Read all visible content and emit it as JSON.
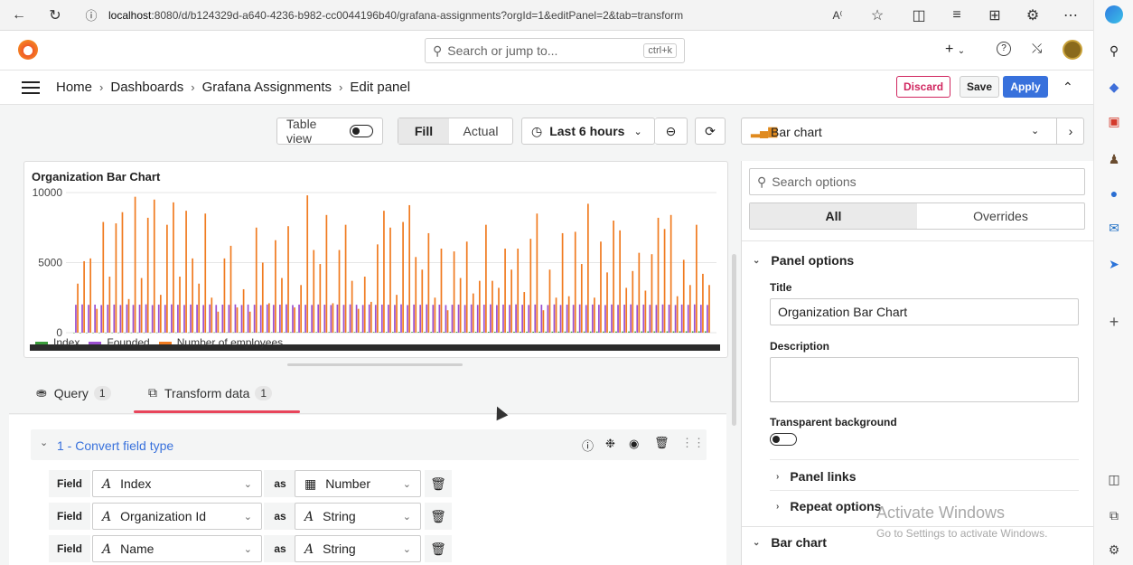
{
  "browser": {
    "url_host": "localhost",
    "url_rest": ":8080/d/b124329d-a640-4236-b982-cc0044196b40/grafana-assignments?orgId=1&editPanel=2&tab=transform"
  },
  "topnav": {
    "search_placeholder": "Search or jump to...",
    "search_shortcut": "ctrl+k",
    "new_label": "+"
  },
  "breadcrumbs": [
    "Home",
    "Dashboards",
    "Grafana Assignments",
    "Edit panel"
  ],
  "actions": {
    "discard": "Discard",
    "save": "Save",
    "apply": "Apply"
  },
  "toolbar": {
    "table_view": "Table view",
    "fill": "Fill",
    "actual": "Actual",
    "time_range": "Last 6 hours"
  },
  "panel": {
    "title": "Organization Bar Chart",
    "legend": [
      {
        "name": "Index",
        "color": "#3a9c3a"
      },
      {
        "name": "Founded",
        "color": "#9b4fcf"
      },
      {
        "name": "Number of employees",
        "color": "#f07b20"
      }
    ]
  },
  "chart_data": {
    "type": "bar",
    "ylim": [
      0,
      10000
    ],
    "yticks": [
      0,
      5000,
      10000
    ],
    "series": [
      {
        "name": "Index",
        "values": [
          1,
          2,
          3,
          4,
          5,
          6,
          7,
          8,
          9,
          10,
          11,
          12,
          13,
          14,
          15,
          16,
          17,
          18,
          19,
          20,
          21,
          22,
          23,
          24,
          25,
          26,
          27,
          28,
          29,
          30,
          31,
          32,
          33,
          34,
          35,
          36,
          37,
          38,
          39,
          40,
          41,
          42,
          43,
          44,
          45,
          46,
          47,
          48,
          49,
          50,
          51,
          52,
          53,
          54,
          55,
          56,
          57,
          58,
          59,
          60,
          61,
          62,
          63,
          64,
          65,
          66,
          67,
          68,
          69,
          70,
          71,
          72,
          73,
          74,
          75,
          76,
          77,
          78,
          79,
          80,
          81,
          82,
          83,
          84,
          85,
          86,
          87,
          88,
          89,
          90,
          91,
          92,
          93,
          94,
          95,
          96,
          97,
          98,
          99,
          100
        ]
      },
      {
        "name": "Founded",
        "values": [
          1990,
          2015,
          1988,
          2001,
          1972,
          1995,
          2006,
          1977,
          2012,
          1983,
          1999,
          2020,
          1970,
          2004,
          1986,
          2018,
          1992,
          1979,
          2009,
          1997,
          1974,
          2014,
          1981,
          2002,
          1989,
          2016,
          1976,
          2008,
          1994,
          1971,
          2011,
          1985,
          2000,
          2019,
          1973,
          2005,
          1991,
          1980,
          2013,
          1998,
          1975,
          2007,
          1987,
          2017,
          1993,
          1978,
          2010,
          1984,
          2003,
          1996,
          1982,
          2021,
          1970,
          2006,
          1990,
          2015,
          1988,
          2001,
          1972,
          1995,
          2006,
          1977,
          2012,
          1983,
          1999,
          2020,
          1970,
          2004,
          1986,
          2018,
          1992,
          1979,
          2009,
          1997,
          1974,
          2014,
          1981,
          2002,
          1989,
          2016,
          1976,
          2008,
          1994,
          1971,
          2011,
          1985,
          2000,
          2019,
          1973,
          2005,
          1991,
          1980,
          2013,
          1998,
          1975,
          2007,
          1987,
          2017,
          1993,
          1978
        ]
      },
      {
        "name": "Number of employees",
        "values": [
          3500,
          5100,
          5300,
          1700,
          7900,
          4000,
          7800,
          8600,
          2400,
          9700,
          3900,
          8200,
          9500,
          2700,
          7700,
          9300,
          4000,
          8700,
          5300,
          3500,
          8500,
          2500,
          1500,
          5300,
          6200,
          1800,
          3100,
          1500,
          7500,
          5000,
          2100,
          6600,
          3900,
          7600,
          1800,
          3400,
          9800,
          5900,
          4900,
          8400,
          2100,
          5900,
          7700,
          3700,
          1700,
          4000,
          2200,
          6300,
          8700,
          7500,
          2700,
          7900,
          9100,
          5400,
          4500,
          7100,
          2500,
          6000,
          1600,
          5800,
          3900,
          6500,
          2800,
          3700,
          7700,
          3700,
          3200,
          6000,
          4500,
          6000,
          2900,
          6700,
          8500,
          1600,
          4500,
          2500,
          7100,
          2600,
          7200,
          4900,
          9200,
          2500,
          6500,
          4300,
          8000,
          7300,
          3200,
          4400,
          5700,
          3000,
          5600,
          8200,
          7400,
          8400,
          2600,
          5200,
          3400,
          7700,
          4200,
          3400
        ]
      }
    ]
  },
  "query_tabs": {
    "query": "Query",
    "query_count": "1",
    "transform": "Transform data",
    "transform_count": "1"
  },
  "transformation": {
    "title": "1 - Convert field type",
    "field_label": "Field",
    "as_label": "as",
    "rows": [
      {
        "field": "Index",
        "type": "Number",
        "type_icon": "number-icon"
      },
      {
        "field": "Organization Id",
        "type": "String",
        "type_icon": "string-icon"
      },
      {
        "field": "Name",
        "type": "String",
        "type_icon": "string-icon"
      }
    ]
  },
  "options": {
    "viz": "Bar chart",
    "search_placeholder": "Search options",
    "tab_all": "All",
    "tab_overrides": "Overrides",
    "panel_options": "Panel options",
    "title_label": "Title",
    "title_value": "Organization Bar Chart",
    "description_label": "Description",
    "description_value": "",
    "transparent_label": "Transparent background",
    "panel_links": "Panel links",
    "repeat_options": "Repeat options",
    "bar_chart": "Bar chart"
  },
  "watermark": {
    "line1": "Activate Windows",
    "line2": "Go to Settings to activate Windows."
  },
  "colors": {
    "accent": "#3871dc",
    "discard": "#d0265f",
    "tab_underline": "#e8455b"
  }
}
